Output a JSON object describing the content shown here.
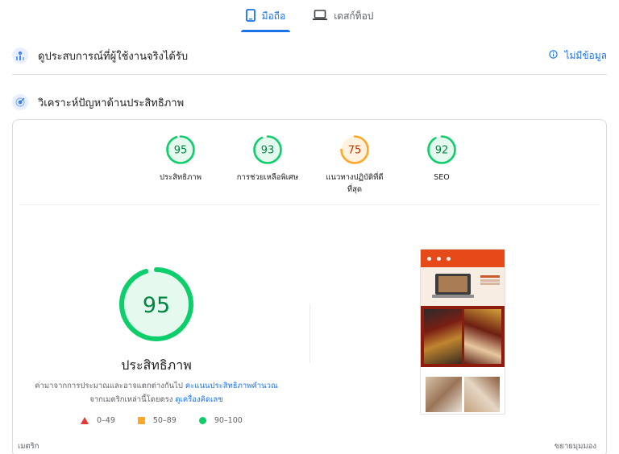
{
  "tabs": [
    {
      "label": "มือถือ",
      "icon": "smartphone-icon",
      "active": true
    },
    {
      "label": "เดสก์ท็อป",
      "icon": "laptop-icon",
      "active": false
    }
  ],
  "field_data": {
    "title": "ดูประสบการณ์ที่ผู้ใช้งานจริงได้รับ",
    "status": "ไม่มีข้อมูล"
  },
  "diagnose": {
    "title": "วิเคราะห์ปัญหาด้านประสิทธิภาพ"
  },
  "scores": [
    {
      "label_lines": [
        "ประสิทธิภาพ"
      ],
      "score": 95,
      "rating": "pass"
    },
    {
      "label_lines": [
        "การช่วยเหลือพิเศษ"
      ],
      "score": 93,
      "rating": "pass"
    },
    {
      "label_lines": [
        "แนวทางปฏิบัติที่ดี",
        "ที่สุด"
      ],
      "score": 75,
      "rating": "average"
    },
    {
      "label_lines": [
        "SEO"
      ],
      "score": 92,
      "rating": "pass"
    }
  ],
  "main_score": {
    "value": 95,
    "title": "ประสิทธิภาพ",
    "desc_part1": "ค่ามาจากการประมาณและอาจแตกต่างกันไป",
    "desc_link1": "คะแนนประสิทธิภาพคำนวณ",
    "desc_part2": "จากเมตริกเหล่านี้โดยตรง",
    "desc_link2": "ดูเครื่องคิดเลข"
  },
  "legend": [
    {
      "range": "0–49",
      "shape": "triangle",
      "color": "#e53935"
    },
    {
      "range": "50–89",
      "shape": "square",
      "color": "#ffa726"
    },
    {
      "range": "90–100",
      "shape": "circle",
      "color": "#0cce6b"
    }
  ],
  "footer": {
    "metrics_label": "เมตริก",
    "expand_label": "ขยายมุมมอง"
  },
  "colors": {
    "pass": "#0cce6b",
    "pass_text": "#018642",
    "pass_bg": "#e6f9ef",
    "average": "#ffa726",
    "average_text": "#c33300",
    "average_bg": "#fff3e0",
    "accent": "#1a73e8"
  }
}
